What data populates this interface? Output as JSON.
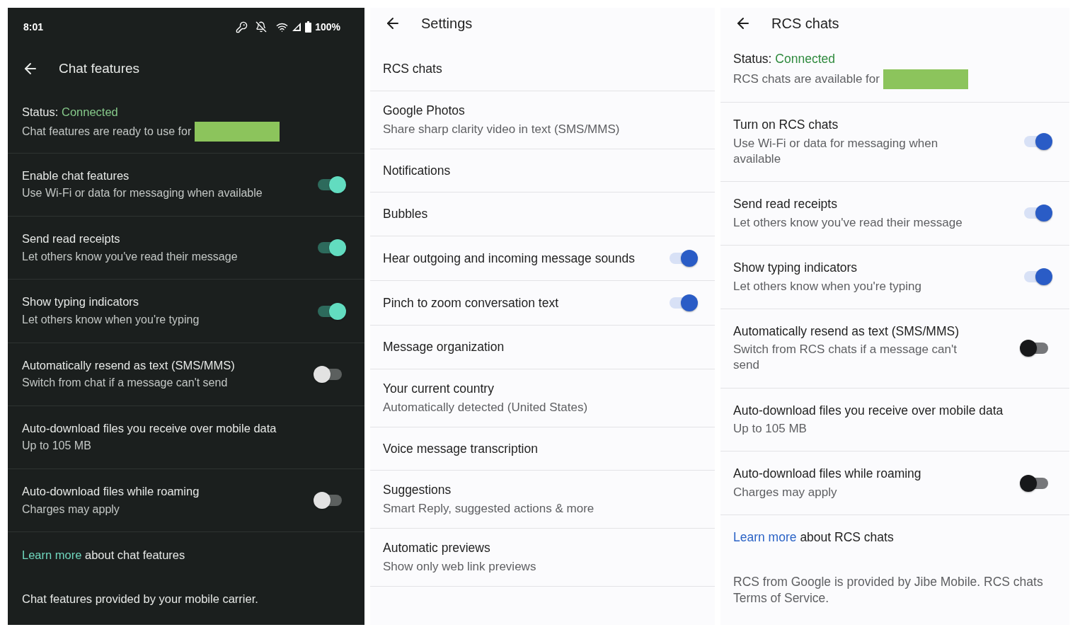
{
  "panels": [
    {
      "kind": "dark",
      "status_bar": {
        "time": "8:01",
        "battery": "100%"
      },
      "title": "Chat features",
      "status": {
        "label": "Status:",
        "value": "Connected",
        "detail": "Chat features are ready to use for"
      },
      "items": [
        {
          "kind": "switch",
          "title": "Enable chat features",
          "subtitle": "Use Wi-Fi or data for messaging when available",
          "on": true
        },
        {
          "kind": "switch",
          "title": "Send read receipts",
          "subtitle": "Let others know you've read their message",
          "on": true
        },
        {
          "kind": "switch",
          "title": "Show typing indicators",
          "subtitle": "Let others know when you're typing",
          "on": true
        },
        {
          "kind": "switch",
          "title": "Automatically resend as text (SMS/MMS)",
          "subtitle": "Switch from chat if a message can't send",
          "on": false
        },
        {
          "kind": "plain",
          "title": "Auto-download files you receive over mobile data",
          "subtitle": "Up to 105 MB"
        },
        {
          "kind": "switch",
          "title": "Auto-download files while roaming",
          "subtitle": "Charges may apply",
          "on": false
        }
      ],
      "learn_more": {
        "link": "Learn more",
        "text": "about chat features"
      },
      "footer": "Chat features provided by your mobile carrier."
    },
    {
      "kind": "light",
      "title": "Settings",
      "items": [
        {
          "kind": "plain",
          "title": "RCS chats"
        },
        {
          "kind": "plain",
          "title": "Google Photos",
          "subtitle": "Share sharp clarity video in text (SMS/MMS)"
        },
        {
          "kind": "plain",
          "title": "Notifications"
        },
        {
          "kind": "plain",
          "title": "Bubbles"
        },
        {
          "kind": "switch",
          "title": "Hear outgoing and incoming message sounds",
          "on": true
        },
        {
          "kind": "switch",
          "title": "Pinch to zoom conversation text",
          "on": true
        },
        {
          "kind": "plain",
          "title": "Message organization"
        },
        {
          "kind": "plain",
          "title": "Your current country",
          "subtitle": "Automatically detected (United States)"
        },
        {
          "kind": "plain",
          "title": "Voice message transcription"
        },
        {
          "kind": "plain",
          "title": "Suggestions",
          "subtitle": "Smart Reply, suggested actions & more"
        },
        {
          "kind": "plain",
          "title": "Automatic previews",
          "subtitle": "Show only web link previews"
        }
      ]
    },
    {
      "kind": "light",
      "title": "RCS chats",
      "status": {
        "label": "Status:",
        "value": "Connected",
        "detail": "RCS chats are available for"
      },
      "items": [
        {
          "kind": "switch",
          "title": "Turn on RCS chats",
          "subtitle": "Use Wi-Fi or data for messaging when available",
          "on": true
        },
        {
          "kind": "switch",
          "title": "Send read receipts",
          "subtitle": "Let others know you've read their message",
          "on": true
        },
        {
          "kind": "switch",
          "title": "Show typing indicators",
          "subtitle": "Let others know when you're typing",
          "on": true
        },
        {
          "kind": "switch",
          "title": "Automatically resend as text (SMS/MMS)",
          "subtitle": "Switch from RCS chats if a message can't send",
          "on": false
        },
        {
          "kind": "plain",
          "title": "Auto-download files you receive over mobile data",
          "subtitle": "Up to 105 MB"
        },
        {
          "kind": "switch",
          "title": "Auto-download files while roaming",
          "subtitle": "Charges may apply",
          "on": false
        }
      ],
      "learn_more": {
        "link": "Learn more",
        "text": "about RCS chats"
      },
      "footer": "RCS from Google is provided by Jibe Mobile. RCS chats Terms of Service."
    }
  ]
}
